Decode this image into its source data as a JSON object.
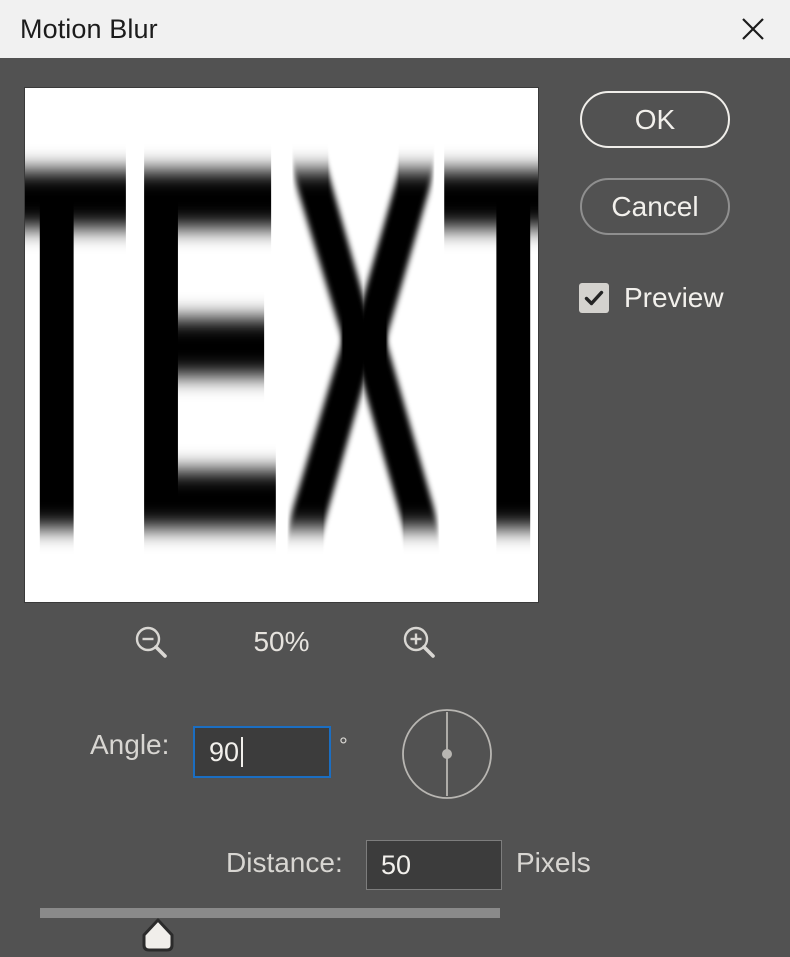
{
  "window": {
    "title": "Motion Blur",
    "close_icon": "close-icon",
    "background_color": "#525252",
    "titlebar_color": "#f1f1f1"
  },
  "preview": {
    "panel_background": "#ffffff",
    "content_text": "EXT",
    "blur_direction": "vertical",
    "zoom": {
      "level": "50%",
      "zoom_out_icon": "magnifier-minus-icon",
      "zoom_in_icon": "magnifier-plus-icon"
    }
  },
  "actions": {
    "ok_label": "OK",
    "cancel_label": "Cancel",
    "ok_border_color": "#f0eeea",
    "cancel_border_color": "#8f8f8f"
  },
  "preview_toggle": {
    "label": "Preview",
    "checked": true,
    "check_icon": "checkmark-icon"
  },
  "angle": {
    "label": "Angle:",
    "value": "90",
    "placeholder": "0",
    "unit": "°",
    "focused": true,
    "focus_color": "#1b6ec2",
    "dial_icon": "angle-dial-icon"
  },
  "distance": {
    "label": "Distance:",
    "value": "50",
    "placeholder": "1",
    "unit": "Pixels"
  },
  "slider": {
    "value": "50",
    "min": "1",
    "max": "2000",
    "thumb_icon": "slider-thumb-icon"
  }
}
